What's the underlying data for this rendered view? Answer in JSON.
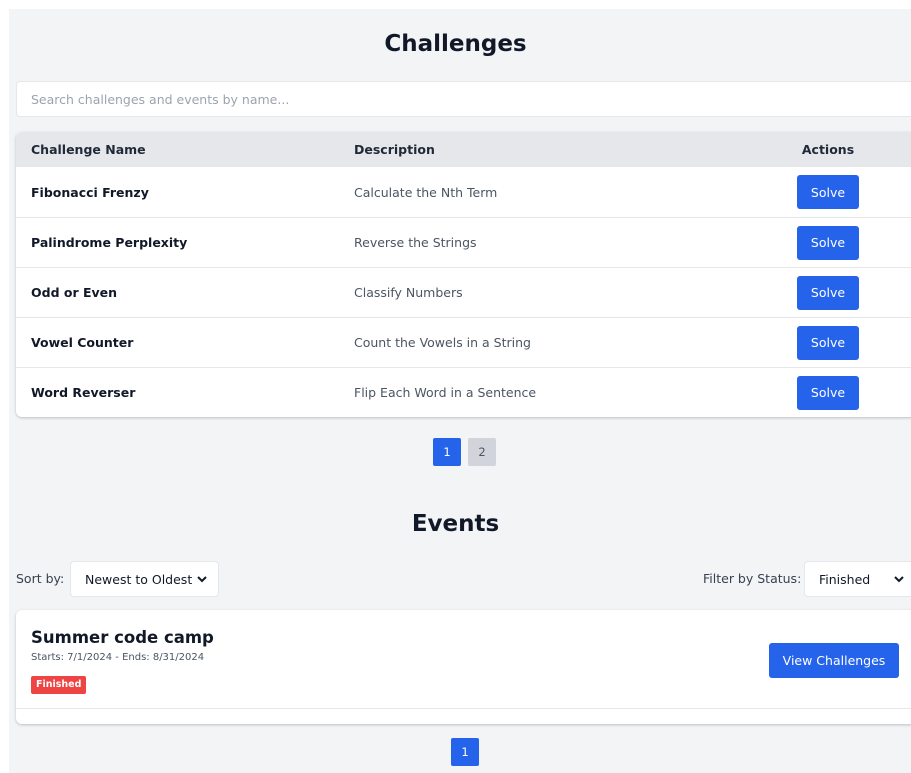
{
  "challenges": {
    "title": "Challenges",
    "search_placeholder": "Search challenges and events by name...",
    "columns": [
      "Challenge Name",
      "Description",
      "Actions"
    ],
    "rows": [
      {
        "name": "Fibonacci Frenzy",
        "description": "Calculate the Nth Term",
        "action": "Solve"
      },
      {
        "name": "Palindrome Perplexity",
        "description": "Reverse the Strings",
        "action": "Solve"
      },
      {
        "name": "Odd or Even",
        "description": "Classify Numbers",
        "action": "Solve"
      },
      {
        "name": "Vowel Counter",
        "description": "Count the Vowels in a String",
        "action": "Solve"
      },
      {
        "name": "Word Reverser",
        "description": "Flip Each Word in a Sentence",
        "action": "Solve"
      }
    ],
    "pagination": {
      "pages": [
        "1",
        "2"
      ],
      "current": "1"
    }
  },
  "events": {
    "title": "Events",
    "sort_label": "Sort by:",
    "sort_value": "Newest to Oldest",
    "filter_label": "Filter by Status:",
    "filter_value": "Finished",
    "items": [
      {
        "name": "Summer code camp",
        "dates": "Starts: 7/1/2024 - Ends: 8/31/2024",
        "status": "Finished",
        "action": "View Challenges"
      }
    ],
    "pagination": {
      "pages": [
        "1"
      ],
      "current": "1"
    }
  },
  "colors": {
    "primary": "#2563eb",
    "status_finished": "#ef4444",
    "page_background": "#f3f4f6",
    "table_header": "#e5e7eb"
  },
  "icons": {
    "select_chevron": "chevron-down-icon"
  }
}
